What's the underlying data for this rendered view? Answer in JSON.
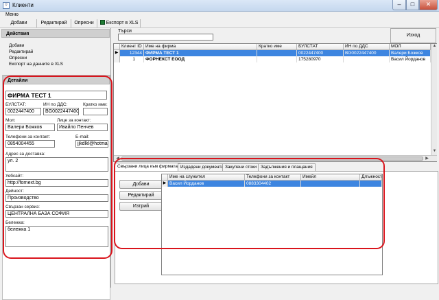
{
  "window": {
    "title": "Клиенти",
    "app_icon": "window-app-icon",
    "min": "–",
    "max": "□",
    "close": "✕"
  },
  "menu": {
    "label": "Меню"
  },
  "toolbar": {
    "add": "Добави",
    "edit": "Редактирай",
    "refresh": "Опресни",
    "export": "Експорт в XLS"
  },
  "actions": {
    "header": "Действия",
    "items": [
      "Добави",
      "Редактирай",
      "Опресни",
      "Експорт на данните в XLS"
    ]
  },
  "details": {
    "header": "Детайли",
    "company": "ФИРМА ТЕСТ 1",
    "bulstat_label": "БУЛСТАТ:",
    "bulstat": "0022447400",
    "vat_label": "ИН по ДДС:",
    "vat": "BG0022447400",
    "short_label": "Кратко име:",
    "short": "",
    "mol_label": "Мол:",
    "mol": "Валери Божков",
    "contact_label": "Лице за контакт:",
    "contact": "Ивайло Пенчев",
    "phone_label": "Телефони за контакт:",
    "phone": "0854004455",
    "email_label": "E-mail:",
    "email": "jjkdlkl@hotmail.com",
    "address_label": "Адрес за доставка:",
    "address": "ул. 2",
    "website_label": "Уебсайт:",
    "website": "http://fornext.bg",
    "activity_label": "Дейност:",
    "activity": "Производство",
    "service_label": "Свързан сервиз:",
    "service": "ЦЕНТРАЛНА БАЗА СОФИЯ",
    "note_label": "Бележка:",
    "note": "бележка 1"
  },
  "search": {
    "label": "Търси",
    "value": ""
  },
  "exit_button": "Изход",
  "clients_grid": {
    "columns": [
      "Клиент ID",
      "Име на фирма",
      "Кратко име",
      "БУЛСТАТ",
      "ИН по ДДС",
      "МОЛ"
    ],
    "rows": [
      [
        "12344",
        "ФИРМА ТЕСТ 1",
        "",
        "0022447400",
        "BG0022447400",
        "Валери Божков"
      ],
      [
        "1",
        "ФОРНЕКСТ ЕООД",
        "",
        "175280970",
        "",
        "Васил Йорданов"
      ]
    ],
    "selected_row": 0
  },
  "tabs": [
    "Свързани лица към фирмата",
    "Издадени документи",
    "Закупени стоки",
    "Задължения и плащания"
  ],
  "related_buttons": {
    "add": "Добави",
    "edit": "Редактирай",
    "delete": "Изтрий"
  },
  "persons_grid": {
    "columns": [
      "Име на служител",
      "Телефони за контакт",
      "Имейл",
      "Длъжност"
    ],
    "rows": [
      [
        "Васил Йорданов",
        "0883304402",
        "",
        ""
      ]
    ],
    "selected_row": 0
  },
  "colors": {
    "selection": "#3d85e0",
    "highlight": "#d9141c"
  }
}
